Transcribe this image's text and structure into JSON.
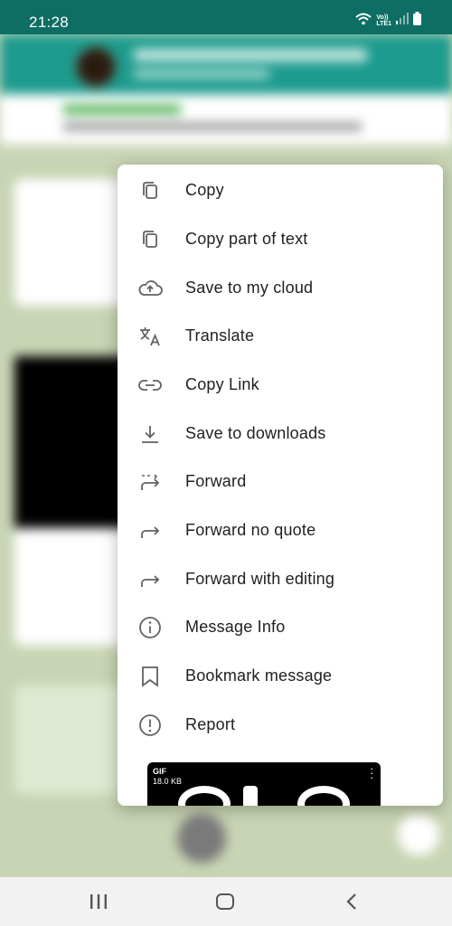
{
  "status_bar": {
    "time": "21:28",
    "network_line1": "Vo))",
    "network_line2": "LTE1",
    "icons": [
      "wifi-icon",
      "signal-icon",
      "battery-icon"
    ]
  },
  "menu": {
    "items": [
      {
        "label": "Copy",
        "icon": "copy-icon"
      },
      {
        "label": "Copy part of text",
        "icon": "copy-part-icon"
      },
      {
        "label": "Save to my cloud",
        "icon": "cloud-upload-icon"
      },
      {
        "label": "Translate",
        "icon": "translate-icon"
      },
      {
        "label": "Copy Link",
        "icon": "link-icon"
      },
      {
        "label": "Save to downloads",
        "icon": "download-icon"
      },
      {
        "label": "Forward",
        "icon": "forward-icon"
      },
      {
        "label": "Forward no quote",
        "icon": "forward-no-quote-icon"
      },
      {
        "label": "Forward with editing",
        "icon": "forward-edit-icon"
      },
      {
        "label": "Message Info",
        "icon": "info-icon"
      },
      {
        "label": "Bookmark message",
        "icon": "bookmark-icon"
      },
      {
        "label": "Report",
        "icon": "report-icon"
      }
    ],
    "gif_preview": {
      "type_label": "GIF",
      "size_label": "18.0 KB",
      "icon": "more-vert-icon"
    }
  },
  "nav_bar": {
    "icons": [
      "recent-apps-icon",
      "home-icon",
      "back-icon"
    ]
  },
  "colors": {
    "status_bar": "#0f6e64",
    "app_bar": "#1d9b8e",
    "icon_gray": "#616161",
    "nav_bar": "#f2f2f2"
  }
}
